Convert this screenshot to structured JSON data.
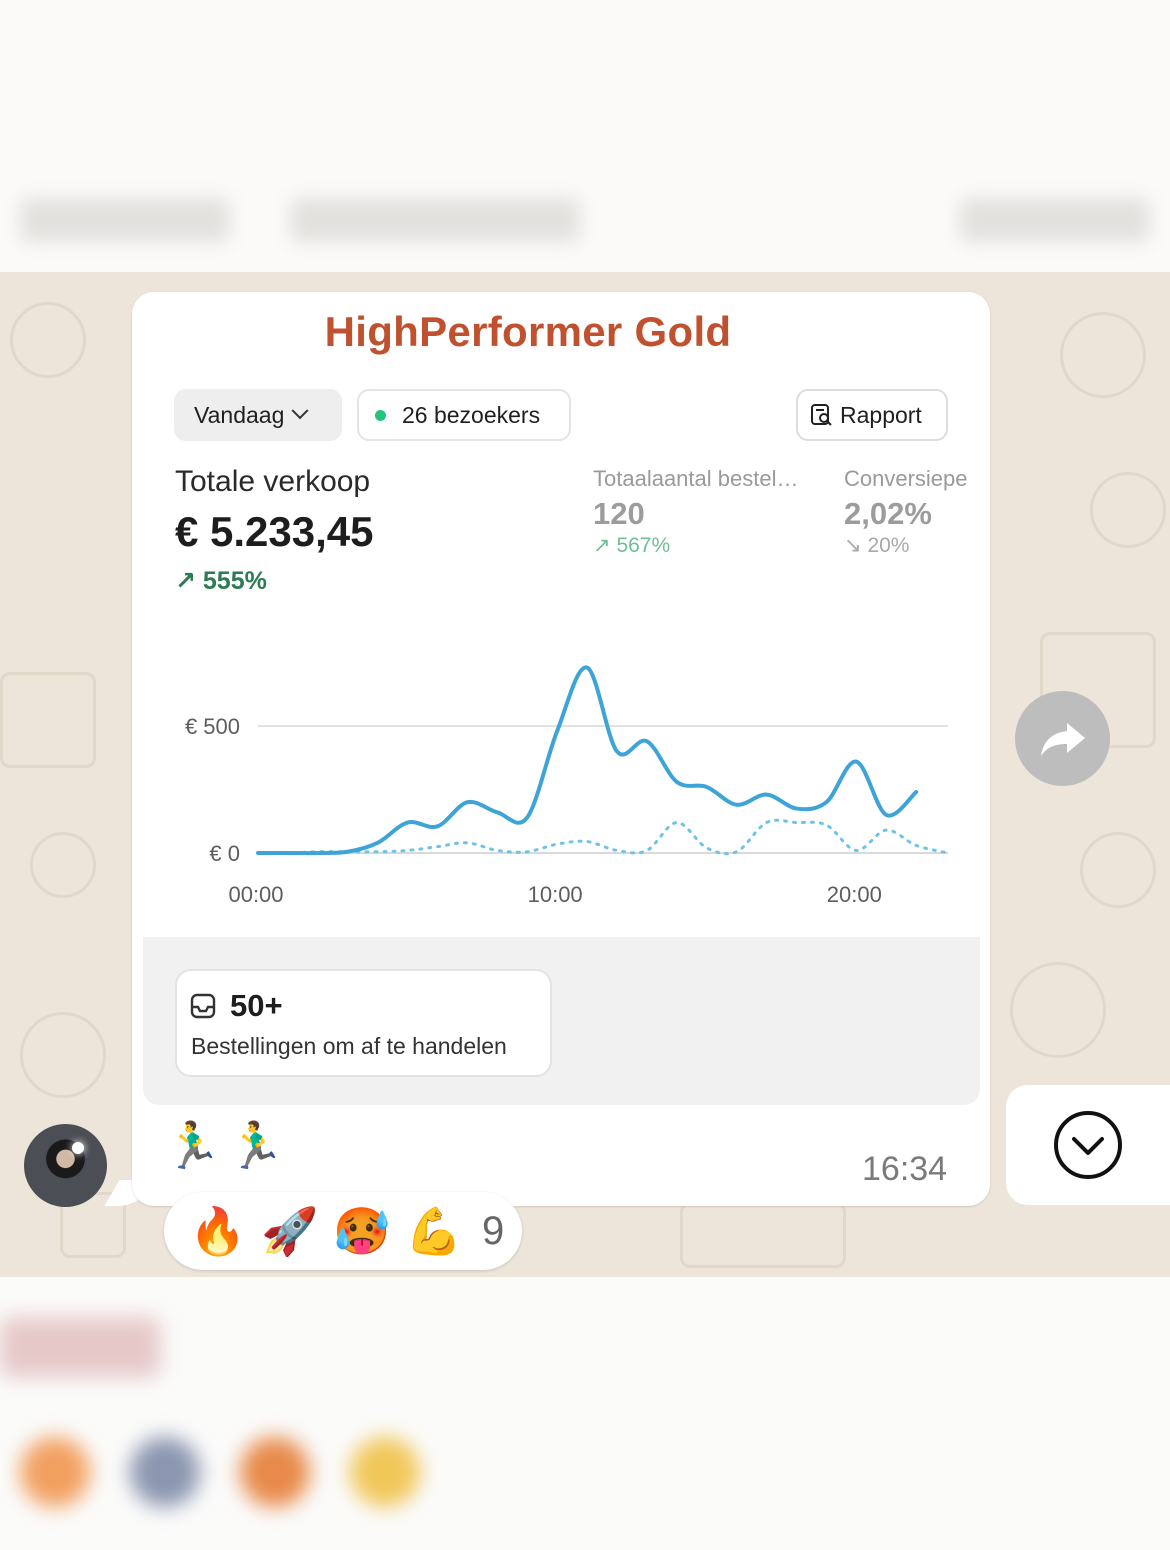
{
  "card": {
    "title": "HighPerformer Gold",
    "date_filter": "Vandaag",
    "visitors": "26 bezoekers",
    "report_button": "Rapport"
  },
  "metrics": {
    "total_sales_label": "Totale verkoop",
    "total_sales_value": "€ 5.233,45",
    "total_sales_change": "555%",
    "orders_label": "Totaalaantal bestel…",
    "orders_value": "120",
    "orders_change": "567%",
    "conversion_label": "Conversiepe",
    "conversion_value": "2,02%",
    "conversion_change": "20%"
  },
  "chart_data": {
    "type": "line",
    "y_tick_labels": [
      "€ 0",
      "€ 500"
    ],
    "x_tick_labels": [
      "00:00",
      "10:00",
      "20:00"
    ],
    "x_hours": [
      0,
      1,
      2,
      3,
      4,
      5,
      6,
      7,
      8,
      9,
      10,
      11,
      12,
      13,
      14,
      15,
      16,
      17,
      18,
      19,
      20,
      21,
      22
    ],
    "ylim": [
      0,
      830
    ],
    "series": [
      {
        "style": "solid",
        "color": "#3ea4d8",
        "values": [
          0,
          0,
          0,
          5,
          40,
          120,
          105,
          200,
          160,
          140,
          480,
          730,
          400,
          440,
          280,
          260,
          190,
          230,
          175,
          200,
          360,
          150,
          240
        ]
      },
      {
        "style": "dotted",
        "color": "#6ec3e6",
        "values": [
          0,
          0,
          5,
          5,
          5,
          10,
          25,
          40,
          10,
          5,
          35,
          45,
          10,
          10,
          120,
          20,
          5,
          120,
          120,
          110,
          10,
          90,
          30
        ]
      }
    ]
  },
  "todo": {
    "count": "50+",
    "label": "Bestellingen om af te handelen"
  },
  "message": {
    "emoji_text": "🏃‍♂️🏃‍♂️",
    "time": "16:34"
  },
  "reactions": {
    "emojis": [
      "🔥",
      "🚀",
      "🥵",
      "💪"
    ],
    "count": "9"
  },
  "colors": {
    "title": "#c0512f",
    "positive": "#2d7b55",
    "line": "#3ea4d8"
  }
}
